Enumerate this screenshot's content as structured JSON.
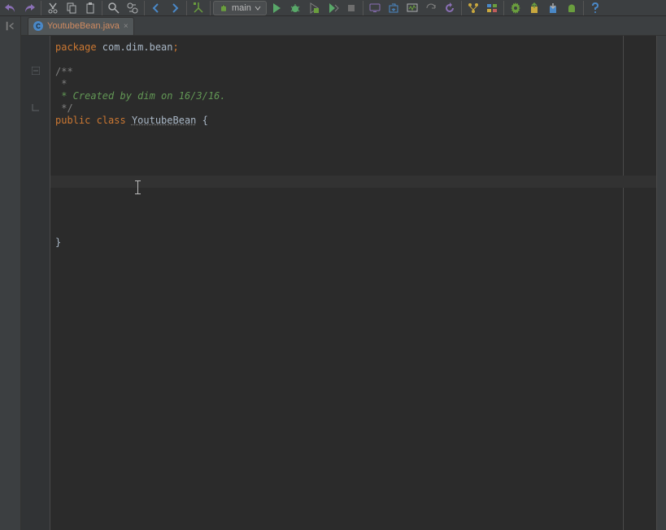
{
  "toolbar": {
    "run_config": {
      "label": "main"
    }
  },
  "tabs": {
    "active": {
      "icon_letter": "C",
      "filename": "YoutubeBean.java"
    }
  },
  "code": {
    "l1_kw": "package",
    "l1_pkg": " com.dim.bean",
    "l1_semi": ";",
    "l3": "/**",
    "l4": " *",
    "l5": " * Created by dim on 16/3/16.",
    "l6": " */",
    "l7_kw1": "public",
    "l7_kw2": " class ",
    "l7_name": "YoutubeBean",
    "l7_brace": " {",
    "l_end": "}"
  }
}
